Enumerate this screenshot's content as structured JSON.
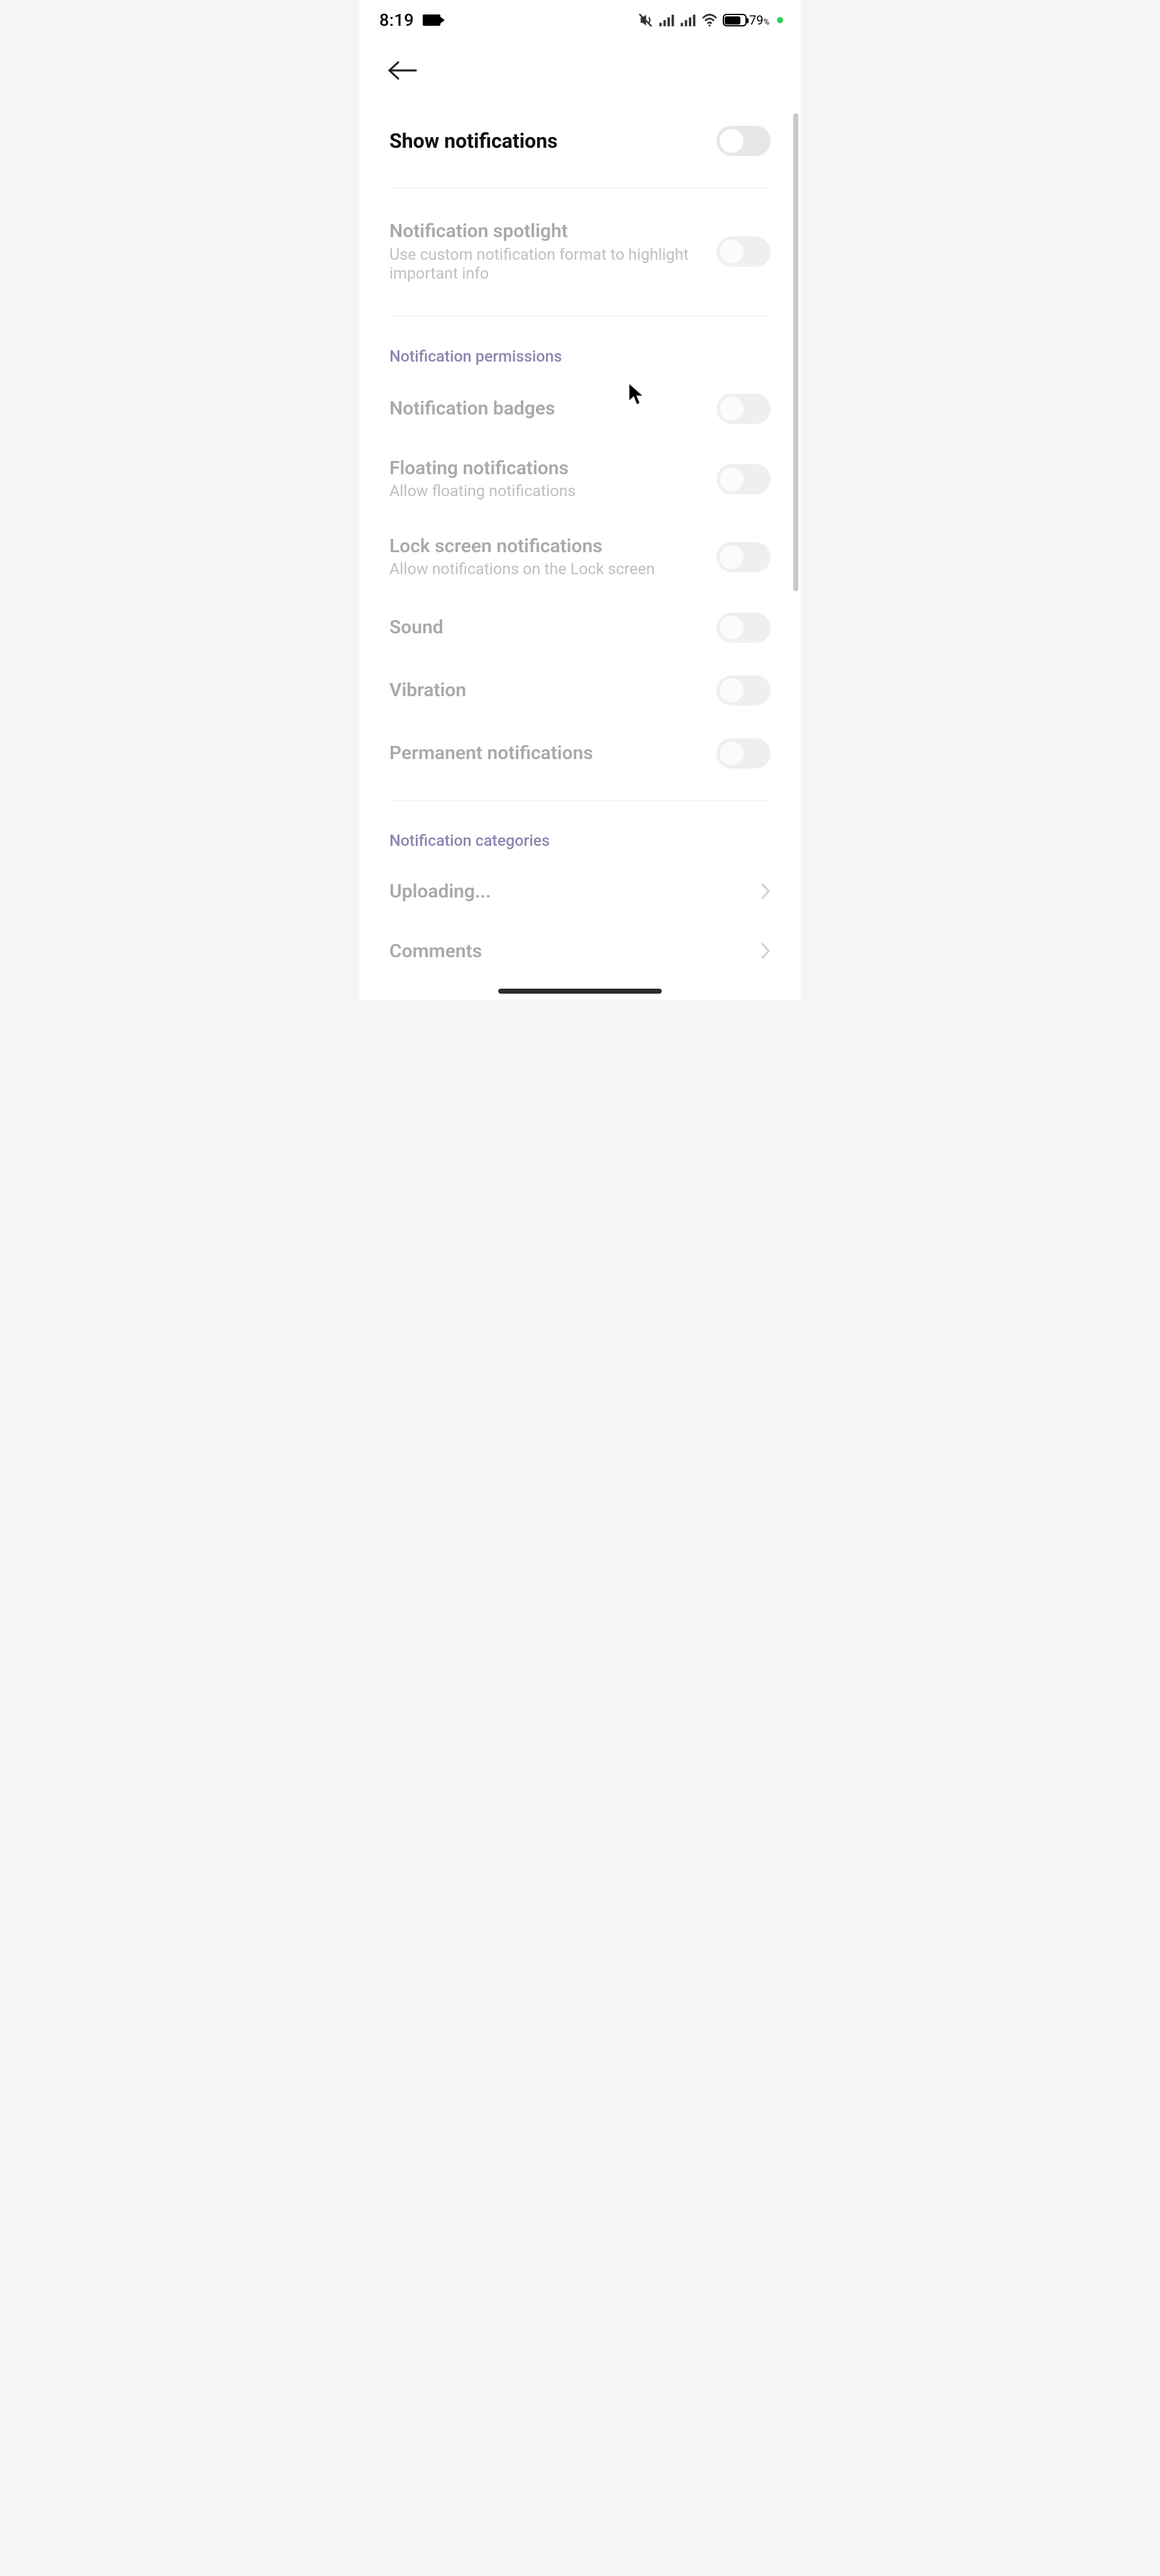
{
  "status": {
    "time": "8:19",
    "battery_percent": "79"
  },
  "settings": {
    "show_notifications": {
      "title": "Show notifications"
    },
    "spotlight": {
      "title": "Notification spotlight",
      "sub": "Use custom notification format to highlight important info"
    },
    "section_permissions": "Notification permissions",
    "badges": {
      "title": "Notification badges"
    },
    "floating": {
      "title": "Floating notifications",
      "sub": "Allow floating notifications"
    },
    "lockscreen": {
      "title": "Lock screen notifications",
      "sub": "Allow notifications on the Lock screen"
    },
    "sound": {
      "title": "Sound"
    },
    "vibration": {
      "title": "Vibration"
    },
    "permanent": {
      "title": "Permanent notifications"
    },
    "section_categories": "Notification categories",
    "uploading": {
      "title": "Uploading..."
    },
    "comments": {
      "title": "Comments"
    }
  }
}
